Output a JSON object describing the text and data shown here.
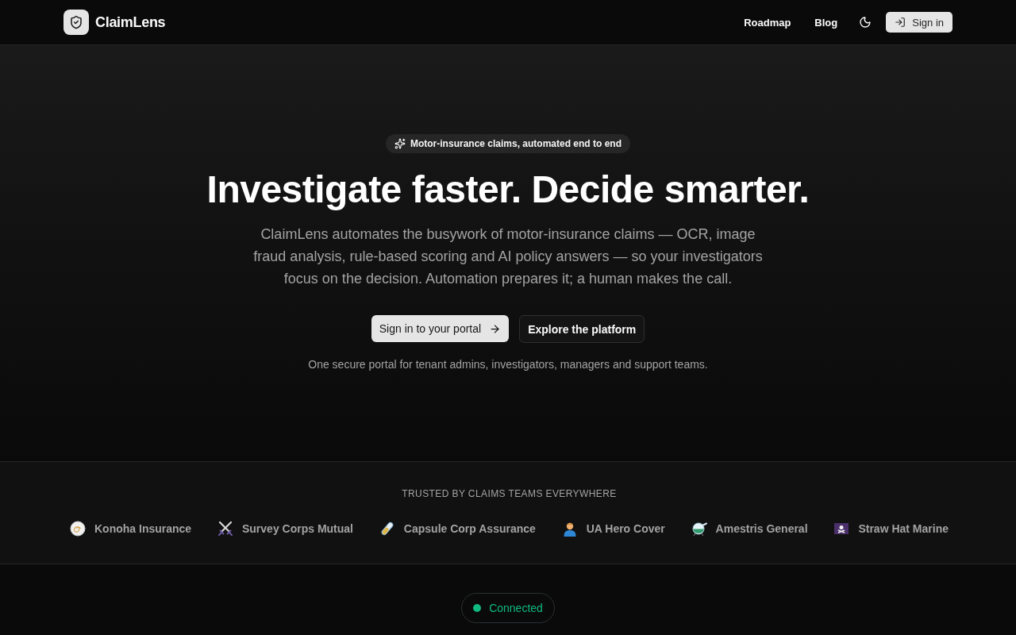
{
  "header": {
    "brand": "ClaimLens",
    "nav": [
      "Roadmap",
      "Blog"
    ],
    "sign_in": "Sign in"
  },
  "hero": {
    "badge": "Motor-insurance claims, automated end to end",
    "title": "Investigate faster. Decide smarter.",
    "description": "ClaimLens automates the busywork of motor-insurance claims — OCR, image fraud analysis, rule-based scoring and AI policy answers — so your investigators focus on the decision. Automation prepares it; a human makes the call.",
    "primary_button": "Sign in to your portal",
    "secondary_button": "Explore the platform",
    "note": "One secure portal for tenant admins, investigators, managers and support teams."
  },
  "trusted": {
    "heading": "TRUSTED BY CLAIMS TEAMS EVERYWHERE",
    "partners": [
      {
        "name": "Konoha Insurance"
      },
      {
        "name": "Survey Corps Mutual"
      },
      {
        "name": "Capsule Corp Assurance"
      },
      {
        "name": "UA Hero Cover"
      },
      {
        "name": "Amestris General"
      },
      {
        "name": "Straw Hat Marine"
      }
    ]
  },
  "status": {
    "label": "Connected",
    "connected": true
  }
}
